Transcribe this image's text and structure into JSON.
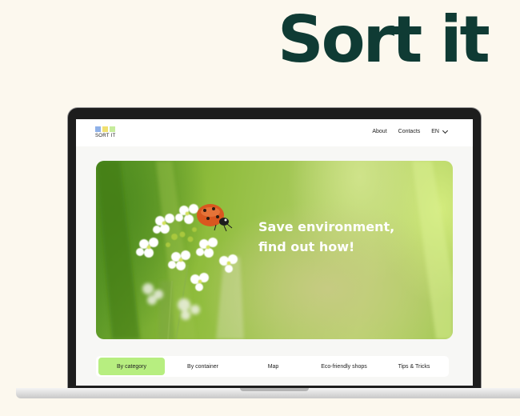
{
  "page": {
    "heading": "Sort it"
  },
  "site": {
    "logo_text": "SORT IT",
    "nav": {
      "about": "About",
      "contacts": "Contacts",
      "language": "EN"
    },
    "hero": {
      "line1": "Save environment,",
      "line2": "find out how!"
    },
    "tabs": [
      {
        "label": "By category",
        "active": true
      },
      {
        "label": "By container",
        "active": false
      },
      {
        "label": "Map",
        "active": false
      },
      {
        "label": "Eco-friendly shops",
        "active": false
      },
      {
        "label": "Tips & Tricks",
        "active": false
      }
    ]
  },
  "colors": {
    "heading": "#0f3b34",
    "active_tab": "#b7ee80",
    "background": "#fcf8ee",
    "logo_squares": [
      "#8fb1e8",
      "#f0e070",
      "#c6ec9c"
    ]
  }
}
